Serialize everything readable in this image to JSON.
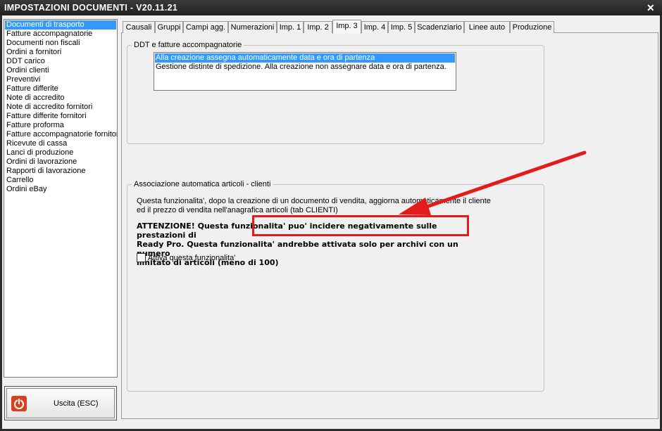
{
  "window": {
    "title": "IMPOSTAZIONI DOCUMENTI - V20.11.21",
    "close_glyph": "✕"
  },
  "sidebar": {
    "items": [
      {
        "label": "Documenti di trasporto",
        "selected": true
      },
      {
        "label": "Fatture accompagnatorie"
      },
      {
        "label": "Documenti non fiscali"
      },
      {
        "label": "Ordini a fornitori"
      },
      {
        "label": "DDT carico"
      },
      {
        "label": "Ordini clienti"
      },
      {
        "label": "Preventivi"
      },
      {
        "label": "Fatture differite"
      },
      {
        "label": "Note di accredito"
      },
      {
        "label": "Note di accredito fornitori"
      },
      {
        "label": "Fatture differite fornitori"
      },
      {
        "label": "Fatture proforma"
      },
      {
        "label": "Fatture accompagnatorie fornitori"
      },
      {
        "label": "Ricevute di cassa"
      },
      {
        "label": "Lanci di produzione"
      },
      {
        "label": "Ordini di lavorazione"
      },
      {
        "label": "Rapporti di lavorazione"
      },
      {
        "label": "Carrello"
      },
      {
        "label": "Ordini eBay"
      }
    ]
  },
  "exit_button": {
    "label": "Uscita (ESC)",
    "icon": "power-icon"
  },
  "tabs": [
    {
      "label": "Causali"
    },
    {
      "label": "Gruppi"
    },
    {
      "label": "Campi agg."
    },
    {
      "label": "Numerazioni"
    },
    {
      "label": "Imp. 1"
    },
    {
      "label": "Imp. 2"
    },
    {
      "label": "Imp. 3",
      "active": true
    },
    {
      "label": "Imp. 4"
    },
    {
      "label": "Imp. 5"
    },
    {
      "label": "Scadenziario"
    },
    {
      "label": "Linee auto"
    },
    {
      "label": "Produzione"
    }
  ],
  "ddt_group": {
    "title": "DDT e fatture accompagnatorie",
    "options": [
      {
        "label": "Alla creazione assegna automaticamente data e ora di partenza",
        "selected": true
      },
      {
        "label": "Gestione distinte di spedizione. Alla creazione non assegnare data e ora di partenza."
      }
    ]
  },
  "assoc_group": {
    "title": "Associazione automatica articoli - clienti",
    "description_line1": "Questa funzionalita', dopo la creazione di un documento di vendita, aggiorna automaticamente il cliente",
    "description_line2": "ed il prezzo di vendita nell'anagrafica articoli (tab CLIENTI)",
    "warning_line1": "ATTENZIONE! Questa funzionalita' puo' incidere negativamente sulle prestazioni di",
    "warning_line2": "Ready Pro. Questa funzionalita' andrebbe attivata solo per archivi con un numero",
    "warning_line3": "limitato di articoli (meno di 100)",
    "checkbox_label": "Attiva questa funzionalita'",
    "checkbox_checked": false
  },
  "annotation": {
    "color": "#e21b1b"
  }
}
